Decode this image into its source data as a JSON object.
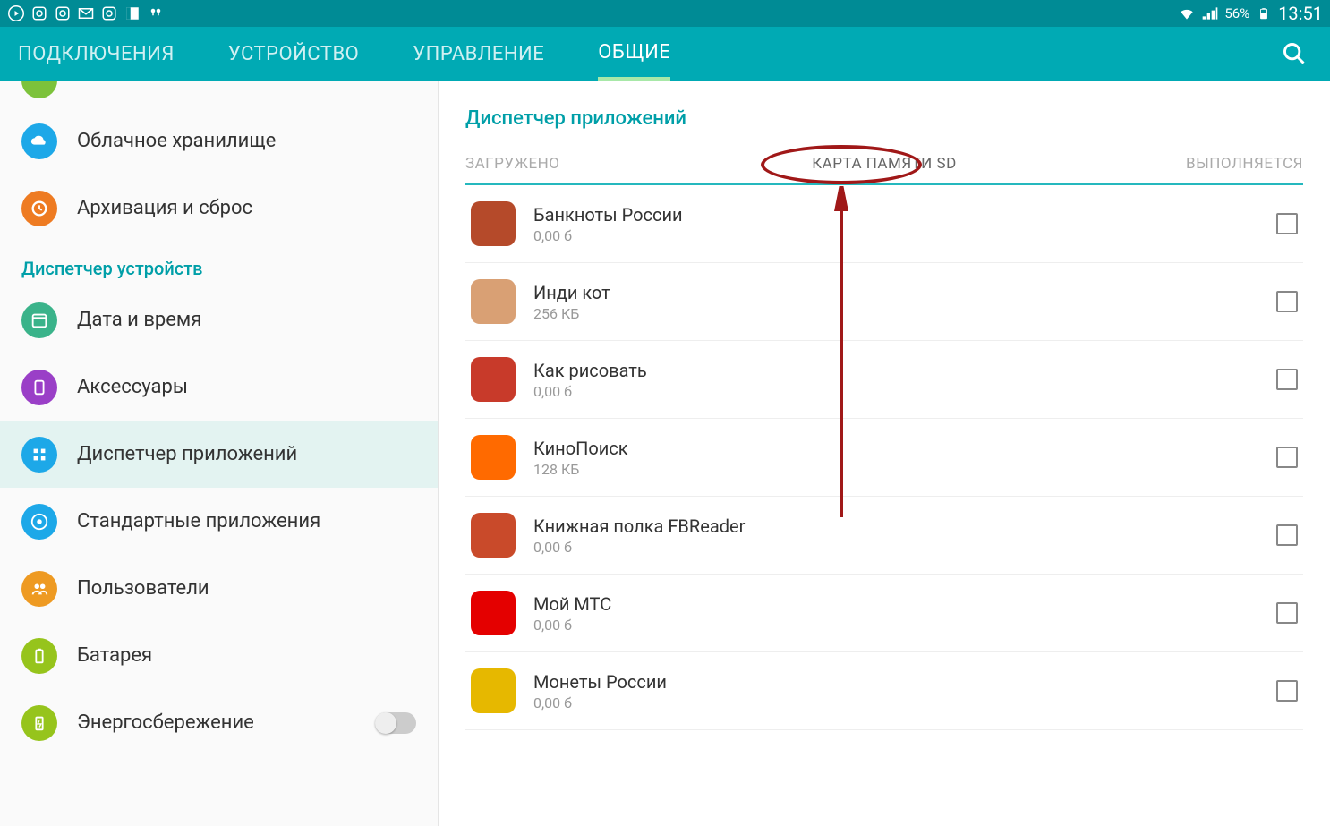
{
  "status": {
    "battery_pct": "56%",
    "time": "13:51"
  },
  "tabs": [
    {
      "label": "ПОДКЛЮЧЕНИЯ"
    },
    {
      "label": "УСТРОЙСТВО"
    },
    {
      "label": "УПРАВЛЕНИЕ"
    },
    {
      "label": "ОБЩИЕ"
    }
  ],
  "sidebar": {
    "section_header": "Диспетчер устройств",
    "items": {
      "cloud": "Облачное хранилище",
      "backup": "Архивация и сброс",
      "datetime": "Дата и время",
      "accessories": "Аксессуары",
      "appmgr": "Диспетчер приложений",
      "defapps": "Стандартные приложения",
      "users": "Пользователи",
      "battery": "Батарея",
      "powersave": "Энергосбережение"
    }
  },
  "panel": {
    "title": "Диспетчер приложений",
    "subtabs": {
      "downloaded": "ЗАГРУЖЕНО",
      "sdcard": "КАРТА ПАМЯТИ SD",
      "running": "ВЫПОЛНЯЕТСЯ"
    }
  },
  "apps": [
    {
      "name": "Банкноты России",
      "size": "0,00 б",
      "icon_bg": "#b54a2a"
    },
    {
      "name": "Инди кот",
      "size": "256 КБ",
      "icon_bg": "#d9a074"
    },
    {
      "name": "Как рисовать",
      "size": "0,00 б",
      "icon_bg": "#c83a2a"
    },
    {
      "name": "КиноПоиск",
      "size": "128 КБ",
      "icon_bg": "#ff6a00"
    },
    {
      "name": "Книжная полка FBReader",
      "size": "0,00 б",
      "icon_bg": "#c94a2a"
    },
    {
      "name": "Мой МТС",
      "size": "0,00 б",
      "icon_bg": "#e40000"
    },
    {
      "name": "Монеты России",
      "size": "0,00 б",
      "icon_bg": "#e6b800"
    }
  ]
}
